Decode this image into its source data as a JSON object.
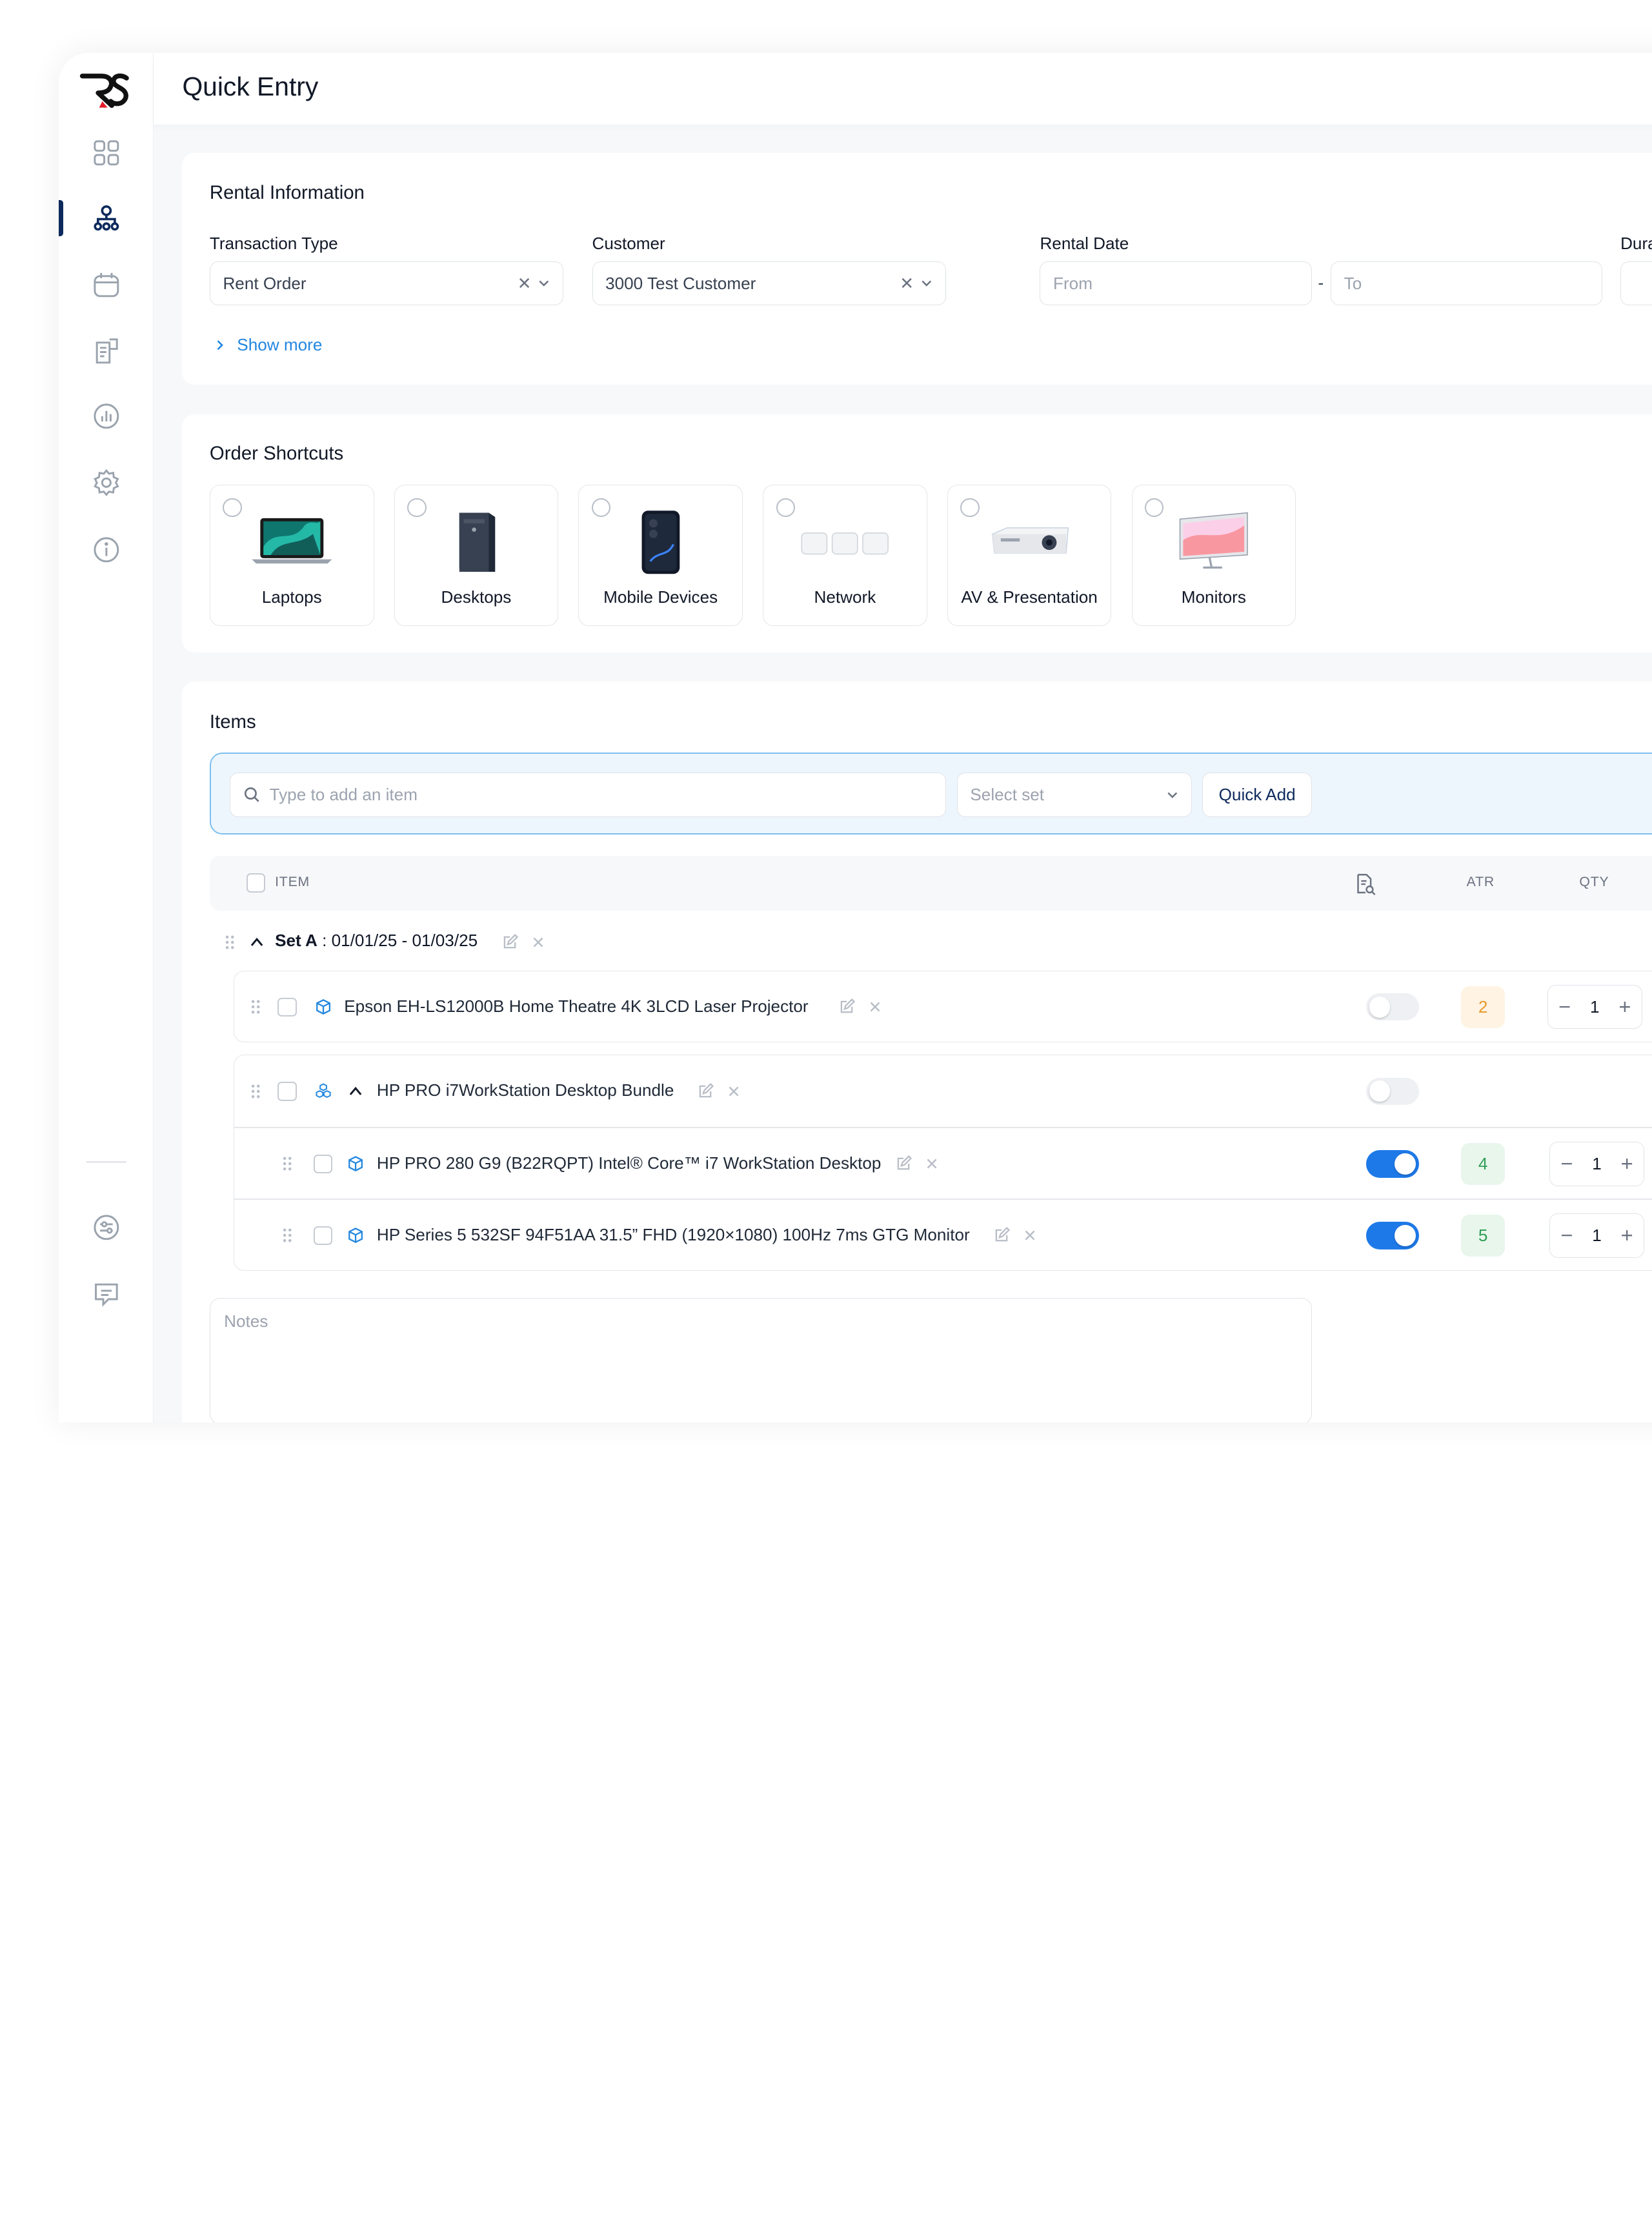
{
  "page": {
    "title": "Quick Entry"
  },
  "sidebar": {
    "items": [
      {
        "icon": "dashboard-grid-icon",
        "active": false
      },
      {
        "icon": "org-hierarchy-icon",
        "active": true
      },
      {
        "icon": "calendar-icon",
        "active": false
      },
      {
        "icon": "document-icon",
        "active": false
      },
      {
        "icon": "reports-chart-icon",
        "active": false
      },
      {
        "icon": "settings-gear-icon",
        "active": false
      },
      {
        "icon": "info-icon",
        "active": false
      }
    ],
    "bottom_items": [
      {
        "icon": "sliders-icon"
      },
      {
        "icon": "chat-icon"
      }
    ]
  },
  "rental_info": {
    "title": "Rental Information",
    "transaction_type": {
      "label": "Transaction Type",
      "value": "Rent Order"
    },
    "customer": {
      "label": "Customer",
      "value": "3000 Test Customer"
    },
    "rental_date": {
      "label": "Rental Date",
      "from_placeholder": "From",
      "to_placeholder": "To",
      "separator": "-"
    },
    "duration": {
      "label": "Dura"
    },
    "show_more": "Show more"
  },
  "shortcuts": {
    "title": "Order Shortcuts",
    "items": [
      {
        "label": "Laptops",
        "icon": "laptop-image"
      },
      {
        "label": "Desktops",
        "icon": "desktop-tower-image"
      },
      {
        "label": "Mobile Devices",
        "icon": "smartphone-image"
      },
      {
        "label": "Network",
        "icon": "mesh-router-image"
      },
      {
        "label": "AV & Presentation",
        "icon": "projector-image"
      },
      {
        "label": "Monitors",
        "icon": "monitor-image"
      }
    ]
  },
  "items": {
    "title": "Items",
    "search_placeholder": "Type to add an item",
    "set_placeholder": "Select set",
    "quick_add": "Quick Add",
    "columns": {
      "item": "ITEM",
      "atr": "ATR",
      "qty": "QTY"
    },
    "set": {
      "name": "Set A",
      "separator": " : ",
      "dates": "01/01/25 - 01/03/25"
    },
    "rows": [
      {
        "name": "Epson EH-LS12000B Home Theatre 4K 3LCD Laser Projector",
        "toggle": false,
        "atr": "2",
        "atr_status": "warn",
        "qty": "1"
      },
      {
        "name": "HP PRO i7WorkStation Desktop Bundle",
        "toggle": false,
        "bundle": true
      },
      {
        "name": "HP PRO 280 G9 (B22RQPT) Intel® Core™ i7 WorkStation Desktop",
        "toggle": true,
        "atr": "4",
        "atr_status": "ok",
        "qty": "1"
      },
      {
        "name": "HP Series 5 532SF 94F51AA 31.5” FHD (1920×1080) 100Hz 7ms GTG Monitor",
        "toggle": true,
        "atr": "5",
        "atr_status": "ok",
        "qty": "1"
      }
    ],
    "notes_placeholder": "Notes"
  },
  "colors": {
    "accent": "#2387e0",
    "brand": "#0d2a5c",
    "toggle_on": "#1e79e8",
    "warn": "#e89a2a",
    "ok": "#2f9e55"
  }
}
